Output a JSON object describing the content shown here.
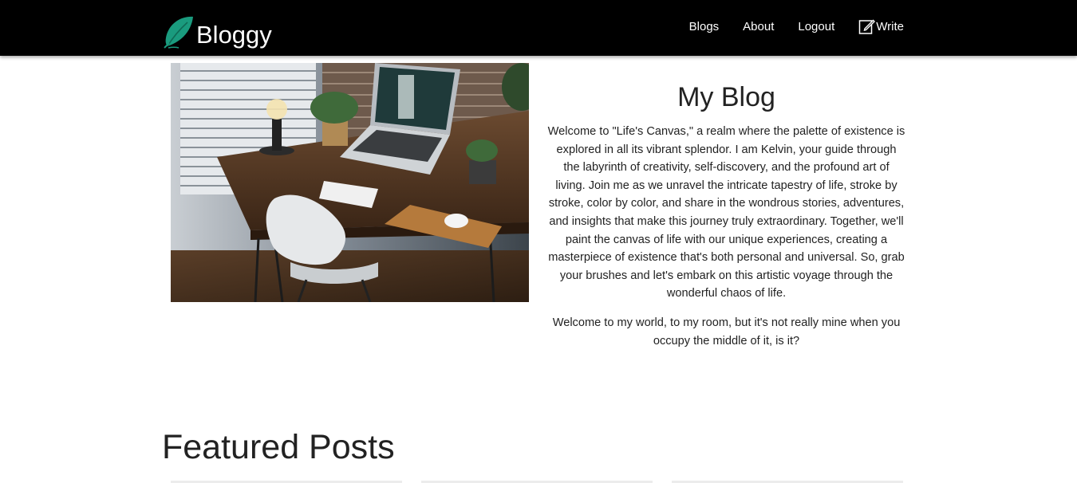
{
  "brand": {
    "name": "Bloggy",
    "icon": "feather-icon",
    "icon_color": "#1a9b7e"
  },
  "nav": {
    "blogs": "Blogs",
    "about": "About",
    "logout": "Logout",
    "write": "Write",
    "write_icon": "pencil-square-icon"
  },
  "hero": {
    "image_description": "desk-workspace-photo",
    "title": "My Blog",
    "paragraph_1": "Welcome to \"Life's Canvas,\" a realm where the palette of existence is explored in all its vibrant splendor. I am Kelvin, your guide through the labyrinth of creativity, self-discovery, and the profound art of living. Join me as we unravel the intricate tapestry of life, stroke by stroke, color by color, and share in the wondrous stories, adventures, and insights that make this journey truly extraordinary. Together, we'll paint the canvas of life with our unique experiences, creating a masterpiece of existence that's both personal and universal. So, grab your brushes and let's embark on this artistic voyage through the wonderful chaos of life.",
    "paragraph_2": "Welcome to my world, to my room, but it's not really mine when you occupy the middle of it, is it?"
  },
  "featured": {
    "title": "Featured Posts"
  },
  "colors": {
    "navbar_bg": "#000000",
    "accent": "#1a9b7e",
    "text": "#222222"
  }
}
